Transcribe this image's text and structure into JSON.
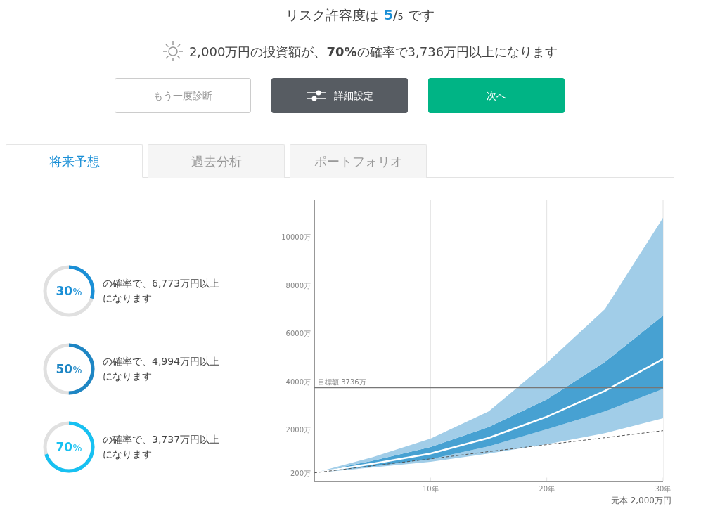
{
  "heading": {
    "prefix": "リスク許容度は",
    "score": "5",
    "separator": "/",
    "max": "5",
    "suffix": "です"
  },
  "summary": "2,000万円の投資額が、**70%**の確率で3,736万円以上になります",
  "buttons": [
    {
      "label": "もう一度診断",
      "kind": "outline"
    },
    {
      "label": "詳細設定",
      "kind": "settings"
    },
    {
      "label": "次へ",
      "kind": "primary"
    }
  ],
  "tabs": [
    {
      "label": "将来予想",
      "selected": true
    },
    {
      "label": "過去分析",
      "selected": false
    },
    {
      "label": "ポートフォリオ",
      "selected": false
    }
  ],
  "probabilities": [
    {
      "value": "30",
      "unit": "%",
      "level": 0.3,
      "color": "#1a8fd6",
      "text": "の確率で、6,773万円以上になります"
    },
    {
      "value": "50",
      "unit": "%",
      "level": 0.5,
      "color": "#1e86c4",
      "text": "の確率で、4,994万円以上になります"
    },
    {
      "value": "70",
      "unit": "%",
      "level": 0.7,
      "color": "#17c1f2",
      "text": "の確率で、3,737万円以上になります"
    }
  ],
  "chart_data": {
    "type": "area",
    "stacked": true,
    "x": [
      0,
      5,
      10,
      15,
      20,
      25,
      30
    ],
    "series": [
      {
        "color": "#ffffff",
        "values": [
          200,
          420,
          660,
          1000,
          1390,
          1850,
          2470
        ]
      },
      {
        "color": "#a1cde8",
        "values": [
          0,
          50,
          110,
          300,
          620,
          900,
          1220
        ]
      },
      {
        "color": "#47a1d2",
        "values": [
          0,
          230,
          500,
          800,
          1240,
          2050,
          3040
        ]
      },
      {
        "color": "#a1cde8",
        "values": [
          0,
          150,
          350,
          650,
          1520,
          2200,
          4070
        ]
      },
      {
        "type": "line",
        "color": "#ffffff",
        "values": [
          200,
          580,
          1000,
          1650,
          2530,
          3600,
          4930
        ]
      },
      {
        "type": "line",
        "line_style": "dashed",
        "color": "#555555",
        "values": [
          200,
          490,
          780,
          1080,
          1370,
          1660,
          1950
        ]
      }
    ],
    "xlim": [
      0,
      30
    ],
    "ylim": [
      -160,
      11550
    ],
    "xticks": [
      {
        "value": 10,
        "label": "10年"
      },
      {
        "value": 20,
        "label": "20年"
      },
      {
        "value": 30,
        "label": "30年"
      }
    ],
    "yticks": [
      {
        "value": 200,
        "label": "200万"
      },
      {
        "value": 2000,
        "label": "2000万"
      },
      {
        "value": 4000,
        "label": "4000万"
      },
      {
        "value": 6000,
        "label": "6000万"
      },
      {
        "value": 8000,
        "label": "8000万"
      },
      {
        "value": 10000,
        "label": "10000万"
      }
    ],
    "ref_lines": [
      {
        "axis": "y",
        "value": 3736,
        "label": "目標額 3736万"
      }
    ]
  },
  "chart_caption": "元本 2,000万円"
}
